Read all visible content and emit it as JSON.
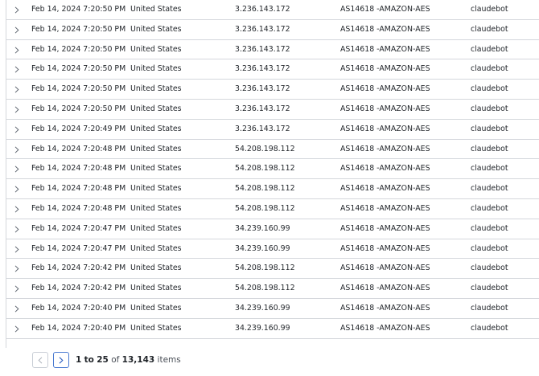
{
  "table": {
    "rows": [
      {
        "date": "Feb 14, 2024 7:20:50 PM",
        "country": "United States",
        "ip": "3.236.143.172",
        "asn": "AS14618 -AMAZON-AES",
        "agent": "claudebot"
      },
      {
        "date": "Feb 14, 2024 7:20:50 PM",
        "country": "United States",
        "ip": "3.236.143.172",
        "asn": "AS14618 -AMAZON-AES",
        "agent": "claudebot"
      },
      {
        "date": "Feb 14, 2024 7:20:50 PM",
        "country": "United States",
        "ip": "3.236.143.172",
        "asn": "AS14618 -AMAZON-AES",
        "agent": "claudebot"
      },
      {
        "date": "Feb 14, 2024 7:20:50 PM",
        "country": "United States",
        "ip": "3.236.143.172",
        "asn": "AS14618 -AMAZON-AES",
        "agent": "claudebot"
      },
      {
        "date": "Feb 14, 2024 7:20:50 PM",
        "country": "United States",
        "ip": "3.236.143.172",
        "asn": "AS14618 -AMAZON-AES",
        "agent": "claudebot"
      },
      {
        "date": "Feb 14, 2024 7:20:50 PM",
        "country": "United States",
        "ip": "3.236.143.172",
        "asn": "AS14618 -AMAZON-AES",
        "agent": "claudebot"
      },
      {
        "date": "Feb 14, 2024 7:20:49 PM",
        "country": "United States",
        "ip": "3.236.143.172",
        "asn": "AS14618 -AMAZON-AES",
        "agent": "claudebot"
      },
      {
        "date": "Feb 14, 2024 7:20:48 PM",
        "country": "United States",
        "ip": "54.208.198.112",
        "asn": "AS14618 -AMAZON-AES",
        "agent": "claudebot"
      },
      {
        "date": "Feb 14, 2024 7:20:48 PM",
        "country": "United States",
        "ip": "54.208.198.112",
        "asn": "AS14618 -AMAZON-AES",
        "agent": "claudebot"
      },
      {
        "date": "Feb 14, 2024 7:20:48 PM",
        "country": "United States",
        "ip": "54.208.198.112",
        "asn": "AS14618 -AMAZON-AES",
        "agent": "claudebot"
      },
      {
        "date": "Feb 14, 2024 7:20:48 PM",
        "country": "United States",
        "ip": "54.208.198.112",
        "asn": "AS14618 -AMAZON-AES",
        "agent": "claudebot"
      },
      {
        "date": "Feb 14, 2024 7:20:47 PM",
        "country": "United States",
        "ip": "34.239.160.99",
        "asn": "AS14618 -AMAZON-AES",
        "agent": "claudebot"
      },
      {
        "date": "Feb 14, 2024 7:20:47 PM",
        "country": "United States",
        "ip": "34.239.160.99",
        "asn": "AS14618 -AMAZON-AES",
        "agent": "claudebot"
      },
      {
        "date": "Feb 14, 2024 7:20:42 PM",
        "country": "United States",
        "ip": "54.208.198.112",
        "asn": "AS14618 -AMAZON-AES",
        "agent": "claudebot"
      },
      {
        "date": "Feb 14, 2024 7:20:42 PM",
        "country": "United States",
        "ip": "54.208.198.112",
        "asn": "AS14618 -AMAZON-AES",
        "agent": "claudebot"
      },
      {
        "date": "Feb 14, 2024 7:20:40 PM",
        "country": "United States",
        "ip": "34.239.160.99",
        "asn": "AS14618 -AMAZON-AES",
        "agent": "claudebot"
      },
      {
        "date": "Feb 14, 2024 7:20:40 PM",
        "country": "United States",
        "ip": "34.239.160.99",
        "asn": "AS14618 -AMAZON-AES",
        "agent": "claudebot"
      }
    ],
    "row_icon": "chevron-right-icon"
  },
  "pagination": {
    "prev_icon": "chevron-left-icon",
    "next_icon": "chevron-right-icon",
    "range_start": "1",
    "to_word": "to",
    "range_end": "25",
    "of_word": "of",
    "total": "13,143",
    "items_word": "items"
  },
  "colors": {
    "border": "#d4d7dc",
    "next_button_border": "#4b7bd1",
    "text": "#1f2328"
  }
}
